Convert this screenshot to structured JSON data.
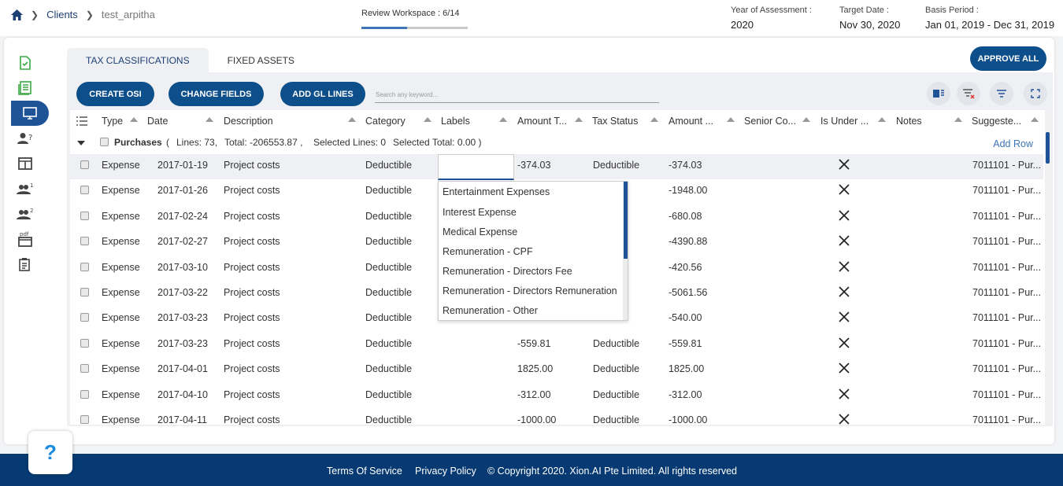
{
  "breadcrumb": {
    "clients": "Clients",
    "client": "test_arpitha"
  },
  "review": {
    "label": "Review Workspace : 6/14",
    "progress": 0.43
  },
  "meta": [
    {
      "label": "Year of Assessment :",
      "value": "2020"
    },
    {
      "label": "Target Date :",
      "value": "Nov 30, 2020"
    },
    {
      "label": "Basis Period :",
      "value": "Jan 01, 2019 - Dec 31, 2019"
    }
  ],
  "tabs": {
    "tax": "TAX CLASSIFICATIONS",
    "fixed": "FIXED ASSETS"
  },
  "approve_all": "APPROVE ALL",
  "toolbar": {
    "create_osi": "CREATE OSI",
    "change_fields": "CHANGE FIELDS",
    "add_gl_lines": "ADD GL LINES",
    "search_placeholder": "Search any keyword..."
  },
  "columns": [
    "Type",
    "Date",
    "Description",
    "Category",
    "Labels",
    "Amount T...",
    "Tax Status",
    "Amount ...",
    "Senior Co...",
    "Is Under ...",
    "Notes",
    "Suggeste..."
  ],
  "group": {
    "name": "Purchases",
    "open": "(",
    "lines": "Lines: 73,",
    "total": "Total: -206553.87 ,",
    "selected_lines": "Selected Lines: 0",
    "selected_total": "Selected Total: 0.00 )",
    "add_row": "Add Row"
  },
  "rows": [
    {
      "type": "Expense",
      "date": "2017-01-19",
      "desc": "Project costs",
      "cat": "Deductible",
      "amt_t": "-374.03",
      "tax_status": "Deductible",
      "amt": "-374.03",
      "suggested": "7011101 - Pur..."
    },
    {
      "type": "Expense",
      "date": "2017-01-26",
      "desc": "Project costs",
      "cat": "Deductible",
      "amt_t": "",
      "tax_status": "ble",
      "amt": "-1948.00",
      "suggested": "7011101 - Pur..."
    },
    {
      "type": "Expense",
      "date": "2017-02-24",
      "desc": "Project costs",
      "cat": "Deductible",
      "amt_t": "",
      "tax_status": "ble",
      "amt": "-680.08",
      "suggested": "7011101 - Pur..."
    },
    {
      "type": "Expense",
      "date": "2017-02-27",
      "desc": "Project costs",
      "cat": "Deductible",
      "amt_t": "",
      "tax_status": "ble",
      "amt": "-4390.88",
      "suggested": "7011101 - Pur..."
    },
    {
      "type": "Expense",
      "date": "2017-03-10",
      "desc": "Project costs",
      "cat": "Deductible",
      "amt_t": "",
      "tax_status": "ble",
      "amt": "-420.56",
      "suggested": "7011101 - Pur..."
    },
    {
      "type": "Expense",
      "date": "2017-03-22",
      "desc": "Project costs",
      "cat": "Deductible",
      "amt_t": "",
      "tax_status": "ble",
      "amt": "-5061.56",
      "suggested": "7011101 - Pur..."
    },
    {
      "type": "Expense",
      "date": "2017-03-23",
      "desc": "Project costs",
      "cat": "Deductible",
      "amt_t": "",
      "tax_status": "ble",
      "amt": "-540.00",
      "suggested": "7011101 - Pur..."
    },
    {
      "type": "Expense",
      "date": "2017-03-23",
      "desc": "Project costs",
      "cat": "Deductible",
      "amt_t": "-559.81",
      "tax_status": "Deductible",
      "amt": "-559.81",
      "suggested": "7011101 - Pur..."
    },
    {
      "type": "Expense",
      "date": "2017-04-01",
      "desc": "Project costs",
      "cat": "Deductible",
      "amt_t": "1825.00",
      "tax_status": "Deductible",
      "amt": "1825.00",
      "suggested": "7011101 - Pur..."
    },
    {
      "type": "Expense",
      "date": "2017-04-10",
      "desc": "Project costs",
      "cat": "Deductible",
      "amt_t": "-312.00",
      "tax_status": "Deductible",
      "amt": "-312.00",
      "suggested": "7011101 - Pur..."
    },
    {
      "type": "Expense",
      "date": "2017-04-11",
      "desc": "Project costs",
      "cat": "Deductible",
      "amt_t": "-1000.00",
      "tax_status": "Deductible",
      "amt": "-1000.00",
      "suggested": "7011101 - Pur..."
    }
  ],
  "dropdown": [
    "Entertainment Expenses",
    "Interest Expense",
    "Medical Expense",
    "Remuneration - CPF",
    "Remuneration - Directors Fee",
    "Remuneration - Directors Remuneration",
    "Remuneration - Other"
  ],
  "help": "?",
  "footer": {
    "terms": "Terms Of Service",
    "privacy": "Privacy Policy",
    "copyright": "© Copyright 2020. Xion.AI Pte Limited. All rights reserved"
  },
  "colors": {
    "primary": "#0d4f8b",
    "nav_active": "#1f5398",
    "footer": "#073a72",
    "link": "#3d75b8",
    "green_icon": "#3aa845"
  }
}
